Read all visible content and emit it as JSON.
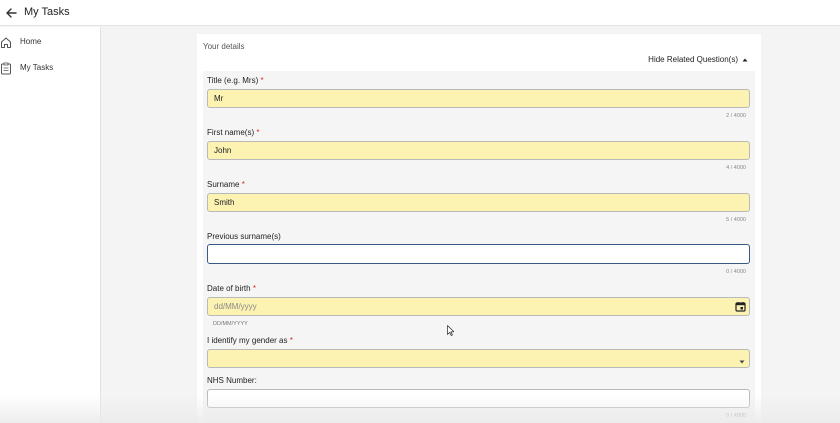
{
  "header": {
    "title": "My Tasks",
    "back_icon": "arrow-left-icon"
  },
  "sidebar": {
    "items": [
      {
        "label": "Home",
        "icon": "home-icon"
      },
      {
        "label": "My Tasks",
        "icon": "clipboard-icon"
      }
    ]
  },
  "form": {
    "section_title": "Your details",
    "toggle_label": "Hide Related Question(s)",
    "required_marker": "*",
    "fields": {
      "title": {
        "label": "Title (e.g. Mrs)",
        "value": "Mr",
        "counter": "2 / 4000"
      },
      "first_name": {
        "label": "First name(s)",
        "value": "John",
        "counter": "4 / 4000"
      },
      "surname": {
        "label": "Surname",
        "value": "Smith",
        "counter": "5 / 4000"
      },
      "previous_surname": {
        "label": "Previous surname(s)",
        "value": "",
        "counter": "0 / 4000"
      },
      "dob": {
        "label": "Date of birth",
        "placeholder": "dd/MM/yyyy",
        "hint": "DD/MM/YYYY"
      },
      "gender": {
        "label": "I identify my gender as",
        "value": ""
      },
      "nhs_number": {
        "label": "NHS Number:",
        "value": "",
        "counter": "0 / 4000"
      }
    }
  },
  "colors": {
    "required_field_bg": "#fcf2b2",
    "required_marker": "#d32f2f",
    "focus_border": "#3a5a86"
  }
}
